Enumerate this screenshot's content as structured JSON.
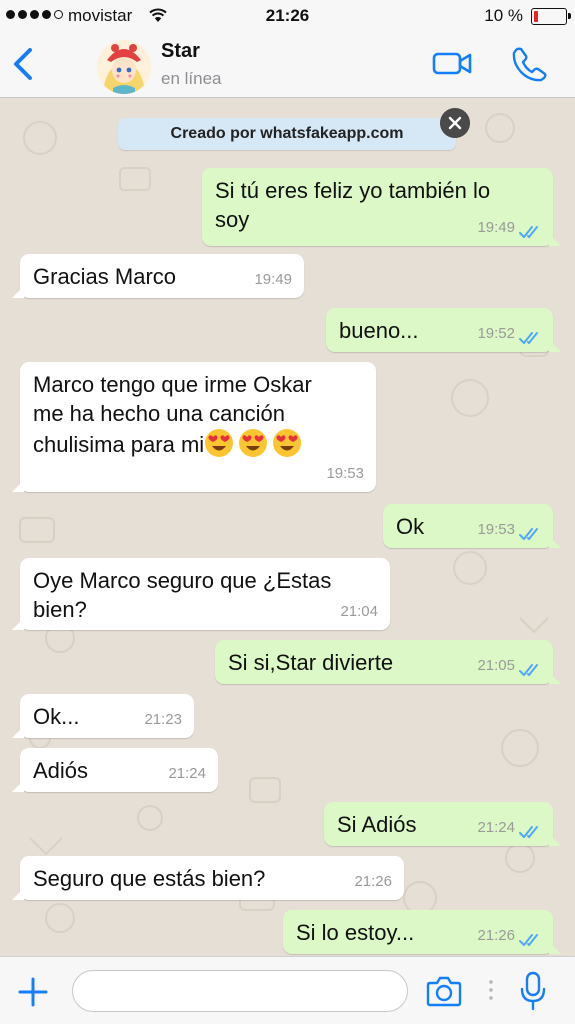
{
  "status_bar": {
    "carrier": "movistar",
    "time": "21:26",
    "battery": "10 %",
    "battery_level": 0.1,
    "signal_bars": 4
  },
  "header": {
    "contact_name": "Star",
    "presence": "en línea",
    "icons": [
      "back-chevron-icon",
      "avatar",
      "video-call-icon",
      "phone-icon"
    ]
  },
  "banner": {
    "text": "Creado por whatsfakeapp.com",
    "close_icon": "close-icon"
  },
  "messages": [
    {
      "dir": "out",
      "text": "Si tú eres feliz yo también lo\nsoy",
      "time": "19:49",
      "ticks": "read"
    },
    {
      "dir": "in",
      "text": "Gracias Marco",
      "time": "19:49"
    },
    {
      "dir": "out",
      "text": "bueno...",
      "time": "19:52",
      "ticks": "read"
    },
    {
      "dir": "in",
      "text": "Marco tengo que irme Oskar\nme ha hecho una canción\nchulisima para mi",
      "emoji": [
        "😍",
        "😍",
        "😍"
      ],
      "time": "19:53"
    },
    {
      "dir": "out",
      "text": "Ok",
      "time": "19:53",
      "ticks": "read"
    },
    {
      "dir": "in",
      "text": "Oye Marco seguro que ¿Estas\nbien?",
      "time": "21:04"
    },
    {
      "dir": "out",
      "text": "Si si,Star  divierte",
      "time": "21:05",
      "ticks": "read"
    },
    {
      "dir": "in",
      "text": "Ok...",
      "time": "21:23"
    },
    {
      "dir": "in",
      "text": " Adiós",
      "time": "21:24"
    },
    {
      "dir": "out",
      "text": "Si Adiós",
      "time": "21:24",
      "ticks": "read"
    },
    {
      "dir": "in",
      "text": "Seguro que estás bien?",
      "time": "21:26"
    },
    {
      "dir": "out",
      "text": "Si lo estoy...",
      "time": "21:26",
      "ticks": "read"
    }
  ],
  "input_bar": {
    "placeholder": "",
    "icons": [
      "plus-icon",
      "camera-icon",
      "microphone-icon"
    ]
  },
  "colors": {
    "accent": "#147efb",
    "outgoing_bubble": "#dcf8c6",
    "incoming_bubble": "#ffffff",
    "chat_background": "#e6dfd6",
    "read_ticks": "#4fa8f5",
    "battery_low": "#e22222"
  }
}
